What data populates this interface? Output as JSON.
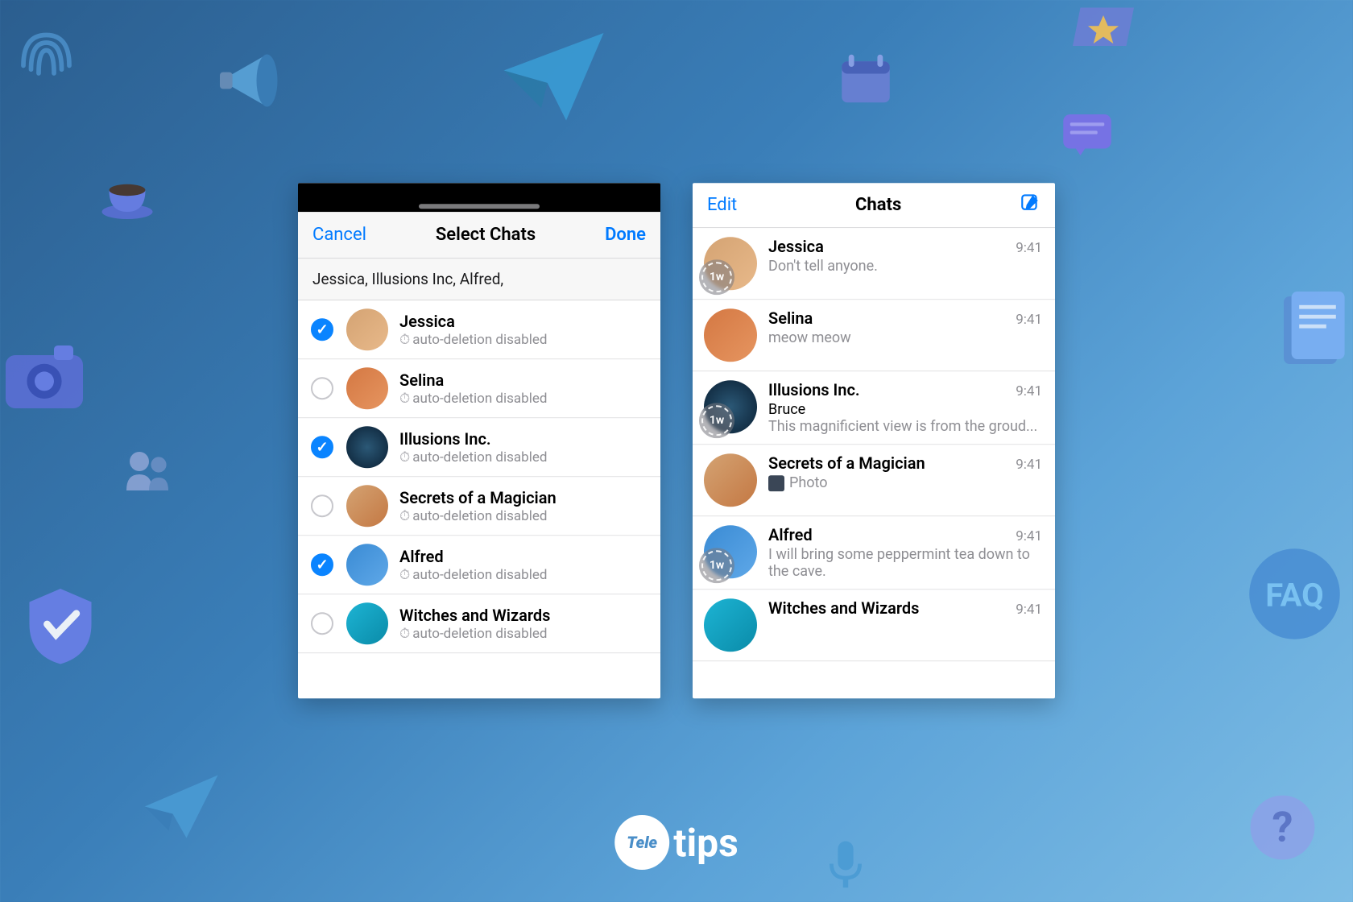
{
  "logo": {
    "tele": "Tele",
    "tips": "tips"
  },
  "left": {
    "cancel": "Cancel",
    "title": "Select Chats",
    "done": "Done",
    "selected_summary": "Jessica, Illusions Inc, Alfred,",
    "sub_label": "auto-deletion disabled",
    "rows": [
      {
        "name": "Jessica",
        "checked": true,
        "avatar": "jessica"
      },
      {
        "name": "Selina",
        "checked": false,
        "avatar": "selina"
      },
      {
        "name": "Illusions Inc.",
        "checked": true,
        "avatar": "illusions"
      },
      {
        "name": "Secrets of a Magician",
        "checked": false,
        "avatar": "secrets"
      },
      {
        "name": "Alfred",
        "checked": true,
        "avatar": "alfred"
      },
      {
        "name": "Witches and Wizards",
        "checked": false,
        "avatar": "witches"
      }
    ]
  },
  "right": {
    "edit": "Edit",
    "title": "Chats",
    "timer_badge": "1w",
    "rows": [
      {
        "name": "Jessica",
        "time": "9:41",
        "msg": "Don't tell anyone.",
        "badge": true,
        "avatar": "jessica"
      },
      {
        "name": "Selina",
        "time": "9:41",
        "msg": "meow meow",
        "badge": false,
        "avatar": "selina"
      },
      {
        "name": "Illusions Inc.",
        "time": "9:41",
        "sender": "Bruce",
        "msg": "This magnificient view is from the groud...",
        "badge": true,
        "avatar": "illusions"
      },
      {
        "name": "Secrets of a Magician",
        "time": "9:41",
        "msg": "Photo",
        "thumb": true,
        "badge": false,
        "avatar": "secrets"
      },
      {
        "name": "Alfred",
        "time": "9:41",
        "msg": "I will bring some peppermint tea down to the cave.",
        "badge": true,
        "avatar": "alfred"
      },
      {
        "name": "Witches and Wizards",
        "time": "9:41",
        "badge": false,
        "avatar": "witches"
      }
    ]
  }
}
